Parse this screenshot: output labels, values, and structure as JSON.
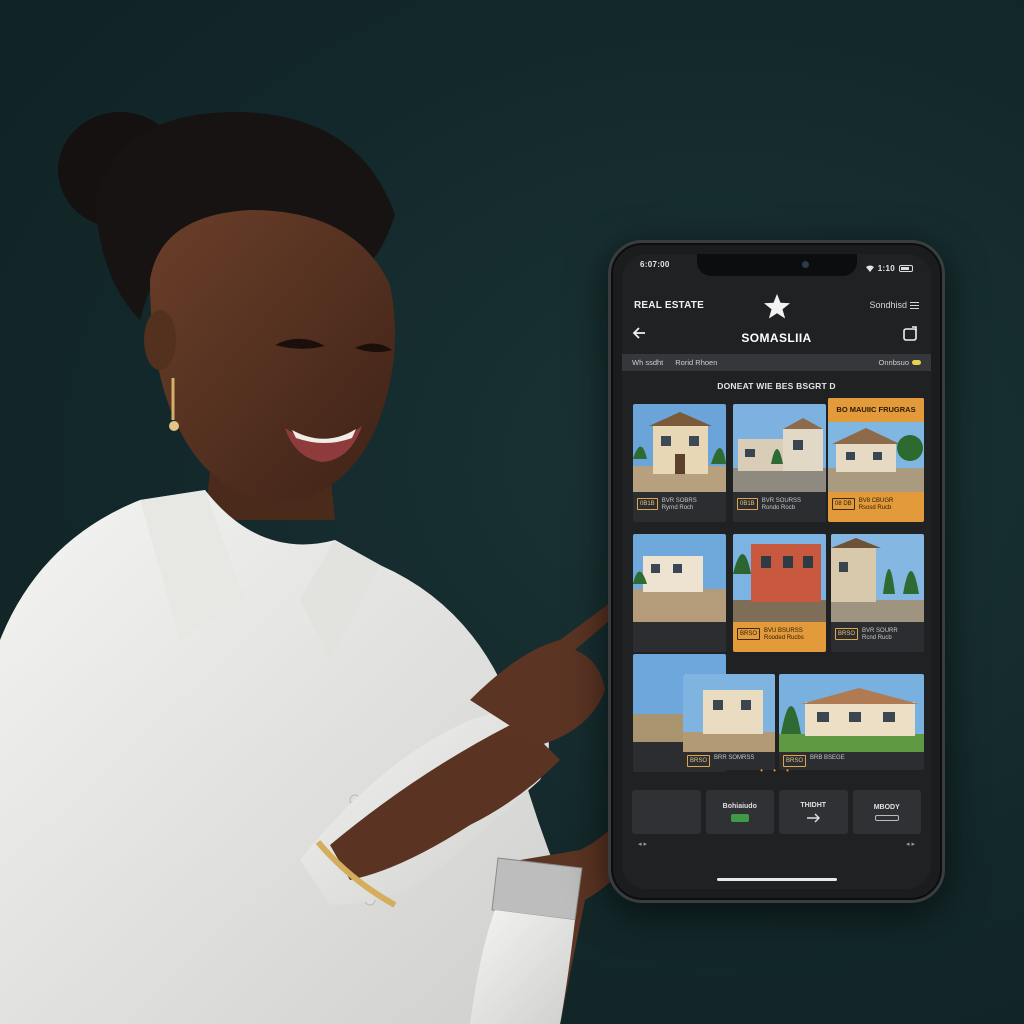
{
  "status_bar": {
    "time": "6:07:00",
    "right": "1:10"
  },
  "header": {
    "brand": "REAL ESTATE",
    "menu_label": "Sondhisd",
    "title": "SOMASLIIA"
  },
  "filters": {
    "left": "Wh ssdht",
    "middle": "Rorid Rhoen",
    "right": "Onnbsuo"
  },
  "section_title": "DONEAT WIE BES BSGRT D",
  "promo_label": "BO MAUIIC FRUGRAS",
  "listings": [
    {
      "badge": "0B1B",
      "caption": "BVR SOBRS",
      "sub": "Ryrnd Roch"
    },
    {
      "badge": "0B1B",
      "caption": "BVR SOURSS",
      "sub": "Rondo Rocb"
    },
    {
      "badge": "08 DB",
      "caption": "BV8 CBUGR",
      "sub": "Rsosd Rucb"
    },
    {
      "badge": "",
      "caption": "",
      "sub": ""
    },
    {
      "badge": "BRSO",
      "caption": "BVU BSURSS",
      "sub": "Rooded Rucbs"
    },
    {
      "badge": "BRSO",
      "caption": "BVR SOURR",
      "sub": "Rcnd Rucb"
    },
    {
      "badge": "",
      "caption": "",
      "sub": ""
    },
    {
      "badge": "BRSO",
      "caption": "BRR SOMRSS",
      "sub": ""
    },
    {
      "badge": "BRSO",
      "caption": "BRB BSEGE",
      "sub": ""
    }
  ],
  "bottom_nav": [
    {
      "label": ""
    },
    {
      "label": "Bohiaiudo"
    },
    {
      "label": "THIDHT"
    },
    {
      "label": "MBODY"
    }
  ],
  "colors": {
    "accent": "#e39a3a",
    "background": "#14282a",
    "screen": "#1f2123"
  }
}
